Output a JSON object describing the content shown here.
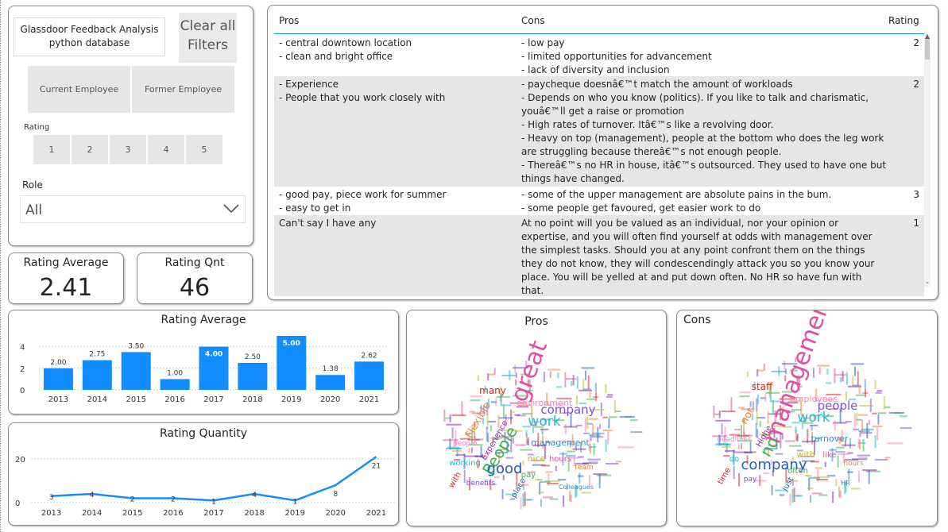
{
  "filters": {
    "title_line1": "Glassdoor Feedback Analysis",
    "title_line2": "python database",
    "clear_label_line1": "Clear all",
    "clear_label_line2": "Filters",
    "employee_buttons": [
      "Current Employee",
      "Former Employee"
    ],
    "rating_label": "Rating",
    "rating_buttons": [
      "1",
      "2",
      "3",
      "4",
      "5"
    ],
    "role_label": "Role",
    "role_value": "All"
  },
  "kpis": {
    "rating_average_label": "Rating Average",
    "rating_average_value": "2.41",
    "rating_qnt_label": "Rating Qnt",
    "rating_qnt_value": "46"
  },
  "table": {
    "headers": {
      "pros": "Pros",
      "cons": "Cons",
      "rating": "Rating"
    },
    "rows": [
      {
        "pros": "- central downtown location\n- clean and bright office",
        "cons": "- low pay\n- limited opportunities for advancement\n- lack of diversity and inclusion",
        "rating": "2"
      },
      {
        "pros": "- Experience\n- People that you work closely with",
        "cons": "- paycheque doesnâ€™t match the amount of workloads\n- Depends on who you know (politics). If you like to talk and charismatic, youâ€™ll get a raise or promotion\n- High rates of turnover. Itâ€™s like a revolving door.\n- Heavy on top (management), people at the bottom who does the leg work are struggling because thereâ€™s not enough people.\n- Thereâ€™s no HR in house, itâ€™s outsourced. They used to have one but things have changed.",
        "rating": "2"
      },
      {
        "pros": "- good pay, piece work for summer\n- easy to get in",
        "cons": "- some of the upper management are absolute pains in the bum.\n- some people get favoured, get easier work to do",
        "rating": "3"
      },
      {
        "pros": "Can't say I have any",
        "cons": "At no point will you be valued as an individual, nor your opinion or expertise, and you will often find yourself at odds with management over the simplest tasks. Should you at any point confront them on the things they do not know, they will condescendingly attack you so you know your place. You will be yelled at and put down often. No HR so have fun with that.",
        "rating": "1"
      }
    ]
  },
  "chart_data": [
    {
      "type": "bar",
      "title": "Rating Average",
      "categories": [
        "2013",
        "2014",
        "2015",
        "2016",
        "2017",
        "2018",
        "2019",
        "2020",
        "2021"
      ],
      "values": [
        2.0,
        2.75,
        3.5,
        1.0,
        4.0,
        2.5,
        5.0,
        1.38,
        2.62
      ],
      "value_labels": [
        "2.00",
        "2.75",
        "3.50",
        "1.00",
        "4.00",
        "2.50",
        "5.00",
        "1.38",
        "2.62"
      ],
      "yticks": [
        "0",
        "2",
        "4"
      ],
      "ylim": [
        0,
        5
      ],
      "color": "#118dff",
      "grid": true
    },
    {
      "type": "line",
      "title": "Rating Quantity",
      "categories": [
        "2013",
        "2014",
        "2015",
        "2016",
        "2017",
        "2018",
        "2019",
        "2020",
        "2021"
      ],
      "values": [
        3,
        4,
        2,
        2,
        1,
        4,
        1,
        8,
        21
      ],
      "value_labels": [
        "3",
        "4",
        "2",
        "2",
        "1",
        "4",
        "1",
        "8",
        "21"
      ],
      "yticks": [
        "0",
        "20"
      ],
      "ylim": [
        0,
        22
      ],
      "color": "#118dff",
      "grid": true
    }
  ],
  "wordclouds": {
    "pros": {
      "title": "Pros",
      "words": [
        "great",
        "People",
        "good",
        "work",
        "company",
        "Flexible",
        "many",
        "environment",
        "management",
        "Experience",
        "nice",
        "hours",
        "pay",
        "place",
        "working",
        "benefits",
        "team",
        "with",
        "people",
        "Colleagues"
      ]
    },
    "cons": {
      "title": "Cons",
      "words": [
        "management",
        "no",
        "company",
        "work",
        "people",
        "not",
        "staff",
        "employees",
        "turnover",
        "Highe",
        "with",
        "like",
        "often",
        "just",
        "do",
        "pay",
        "hours",
        "time",
        "deadlines",
        "HR"
      ]
    }
  },
  "colors": {
    "accent": "#118dff",
    "border": "#8a8a8a",
    "shade": "#e6e6e6"
  }
}
